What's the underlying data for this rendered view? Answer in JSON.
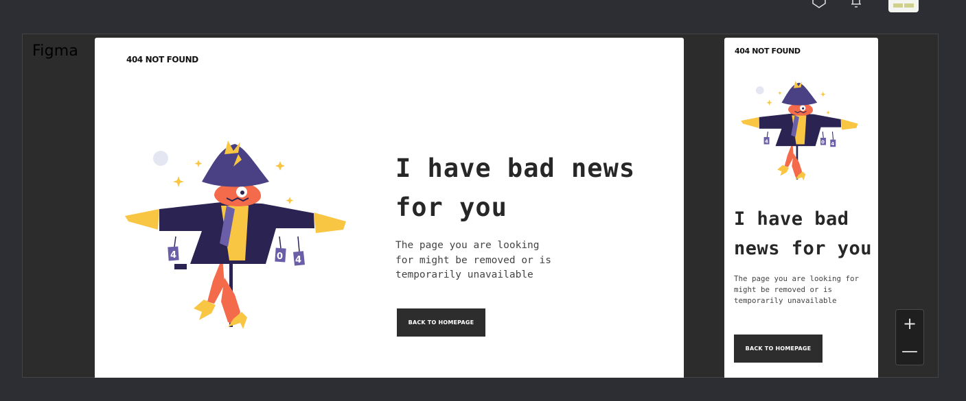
{
  "toolbar": {
    "icons": [
      "share-icon",
      "bell-icon"
    ],
    "thumbnail_colors": {
      "background": "#f4f4f0",
      "accent": "#cfd08c"
    }
  },
  "canvas": {
    "label": "Figma",
    "background": "#2c2c2c"
  },
  "desktop_frame": {
    "brand": "404 NOT FOUND",
    "headline": "I have bad news for you",
    "body": "The page you are looking for might be removed or is temporarily unavailable",
    "button_label": "BACK TO HOMEPAGE"
  },
  "mobile_frame": {
    "brand": "404 NOT FOUND",
    "headline": "I have bad news for you",
    "body": "The page you are looking for might be removed or is temporarily unavailable",
    "button_label": "BACK TO HOMEPAGE"
  },
  "zoom_controls": {
    "zoom_in": "+",
    "zoom_out": "—"
  },
  "illustration": {
    "signs": [
      "4",
      "0",
      "4"
    ],
    "colors": {
      "hat": "#4a4184",
      "coat": "#2b2352",
      "face": "#f36b4a",
      "straw": "#f9c644",
      "scarf": "#6a5ea8",
      "pole": "#2b2352",
      "moon": "#e4e7f2"
    }
  }
}
